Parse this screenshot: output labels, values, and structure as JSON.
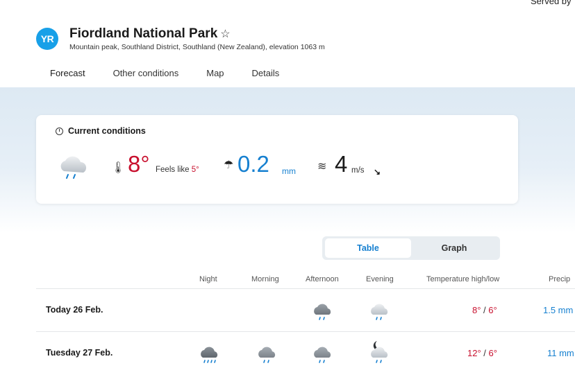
{
  "header": {
    "served_by": "Served by",
    "logo_text": "YR",
    "title": "Fiordland National Park",
    "star": "☆",
    "subtitle": "Mountain peak, Southland District, Southland (New Zealand), elevation 1063 m"
  },
  "tabs": [
    {
      "label": "Forecast",
      "active": true
    },
    {
      "label": "Other conditions"
    },
    {
      "label": "Map"
    },
    {
      "label": "Details"
    }
  ],
  "current": {
    "heading": "Current conditions",
    "icon": "rain-cloud-icon",
    "temperature": "8°",
    "feels_like_label": "Feels like",
    "feels_like_value": "5°",
    "precipitation": "0.2",
    "precipitation_unit": "mm",
    "wind": "4",
    "wind_unit": "m/s",
    "wind_direction": "↘"
  },
  "view_toggle": {
    "table": "Table",
    "graph": "Graph",
    "selected": "Table"
  },
  "table": {
    "headers": [
      "Night",
      "Morning",
      "Afternoon",
      "Evening",
      "Temperature high/low",
      "Precip"
    ],
    "rows": [
      {
        "date": "Today 26 Feb.",
        "night": "",
        "morning": "",
        "afternoon": "rain-cloud-icon",
        "evening": "rain-cloud-icon",
        "high": "8°",
        "low": "6°",
        "precip": "1.5 mm"
      },
      {
        "date": "Tuesday 27 Feb.",
        "night": "heavy-rain-cloud-icon",
        "morning": "rain-cloud-icon",
        "afternoon": "rain-cloud-icon",
        "evening": "moon-rain-cloud-icon",
        "high": "12°",
        "low": "6°",
        "precip": "11 mm"
      }
    ]
  },
  "colors": {
    "accent": "#1680d0",
    "warm": "#c8102e",
    "brand": "#18a0e8"
  }
}
